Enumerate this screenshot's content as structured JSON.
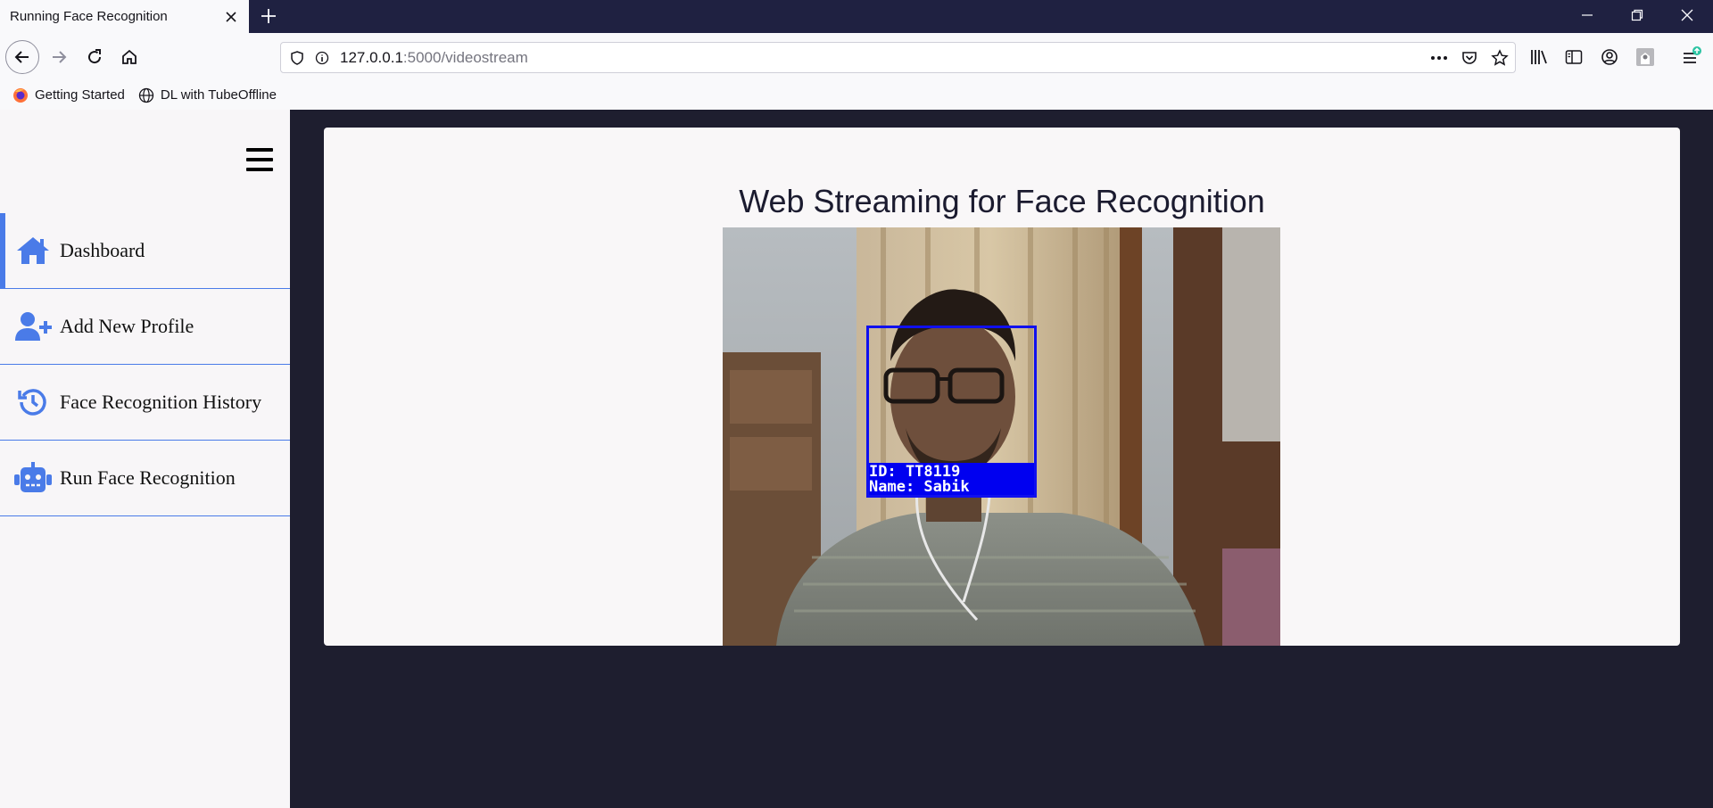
{
  "browser": {
    "tab_title": "Running Face Recognition",
    "url_host": "127.0.0.1",
    "url_path": ":5000/videostream",
    "bookmarks": [
      {
        "label": "Getting Started",
        "icon": "firefox-icon"
      },
      {
        "label": "DL with TubeOffline",
        "icon": "globe-icon"
      }
    ]
  },
  "sidebar": {
    "items": [
      {
        "label": "Dashboard",
        "icon": "home-icon",
        "active": true
      },
      {
        "label": "Add New Profile",
        "icon": "user-plus-icon",
        "active": false
      },
      {
        "label": "Face Recognition History",
        "icon": "history-icon",
        "active": false
      },
      {
        "label": "Run Face Recognition",
        "icon": "robot-icon",
        "active": false
      }
    ]
  },
  "main": {
    "title": "Web Streaming for Face Recognition",
    "detection": {
      "id_line": "ID: TT8119",
      "name_line": "Name: Sabik"
    }
  },
  "colors": {
    "accent": "#4a7be8",
    "page_bg": "#1e1e2f",
    "detection_box": "#0000f0"
  }
}
